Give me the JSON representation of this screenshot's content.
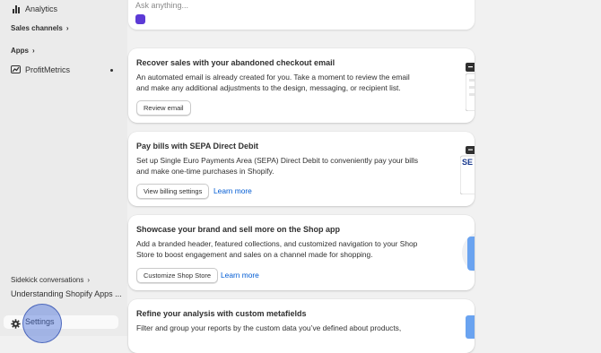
{
  "sidebar": {
    "analytics": {
      "label": "Analytics",
      "icon": "bar-chart-icon"
    },
    "sales_channels": {
      "label": "Sales channels",
      "chevron": "›"
    },
    "apps": {
      "label": "Apps",
      "chevron": "›"
    },
    "profitmetrics": {
      "label": "ProfitMetrics",
      "icon": "trend-line-icon"
    },
    "sidekick": {
      "label": "Sidekick conversations",
      "chevron": "›"
    },
    "conversation": {
      "label": "Understanding Shopify Apps ..."
    },
    "settings": {
      "label": "Settings",
      "icon": "gear-icon"
    }
  },
  "ask": {
    "placeholder": "Ask anything..."
  },
  "cards": [
    {
      "title": "Recover sales with your abandoned checkout email",
      "description": "An automated email is already created for you. Take a moment to review the email and make any additional adjustments to the design, messaging, or recipient list.",
      "button": "Review email",
      "link": ""
    },
    {
      "title": "Pay bills with SEPA Direct Debit",
      "description": "Set up Single Euro Payments Area (SEPA) Direct Debit to conveniently pay your bills and make one-time purchases in Shopify.",
      "button": "View billing settings",
      "link": "Learn more",
      "illustration_text": "SE"
    },
    {
      "title": "Showcase your brand and sell more on the Shop app",
      "description": "Add a branded header, featured collections, and customized navigation to your Shop Store to boost engagement and sales on a channel made for shopping.",
      "button": "Customize Shop Store",
      "link": "Learn more"
    },
    {
      "title": "Refine your analysis with custom metafields",
      "description": "Filter and group your reports by the custom data you’ve defined about products,",
      "button": "",
      "link": ""
    }
  ],
  "colors": {
    "link": "#005bd3",
    "sidebar_bg": "#ebebeb",
    "page_bg": "#f1f1f1",
    "cursor_halo": "#466edc"
  }
}
